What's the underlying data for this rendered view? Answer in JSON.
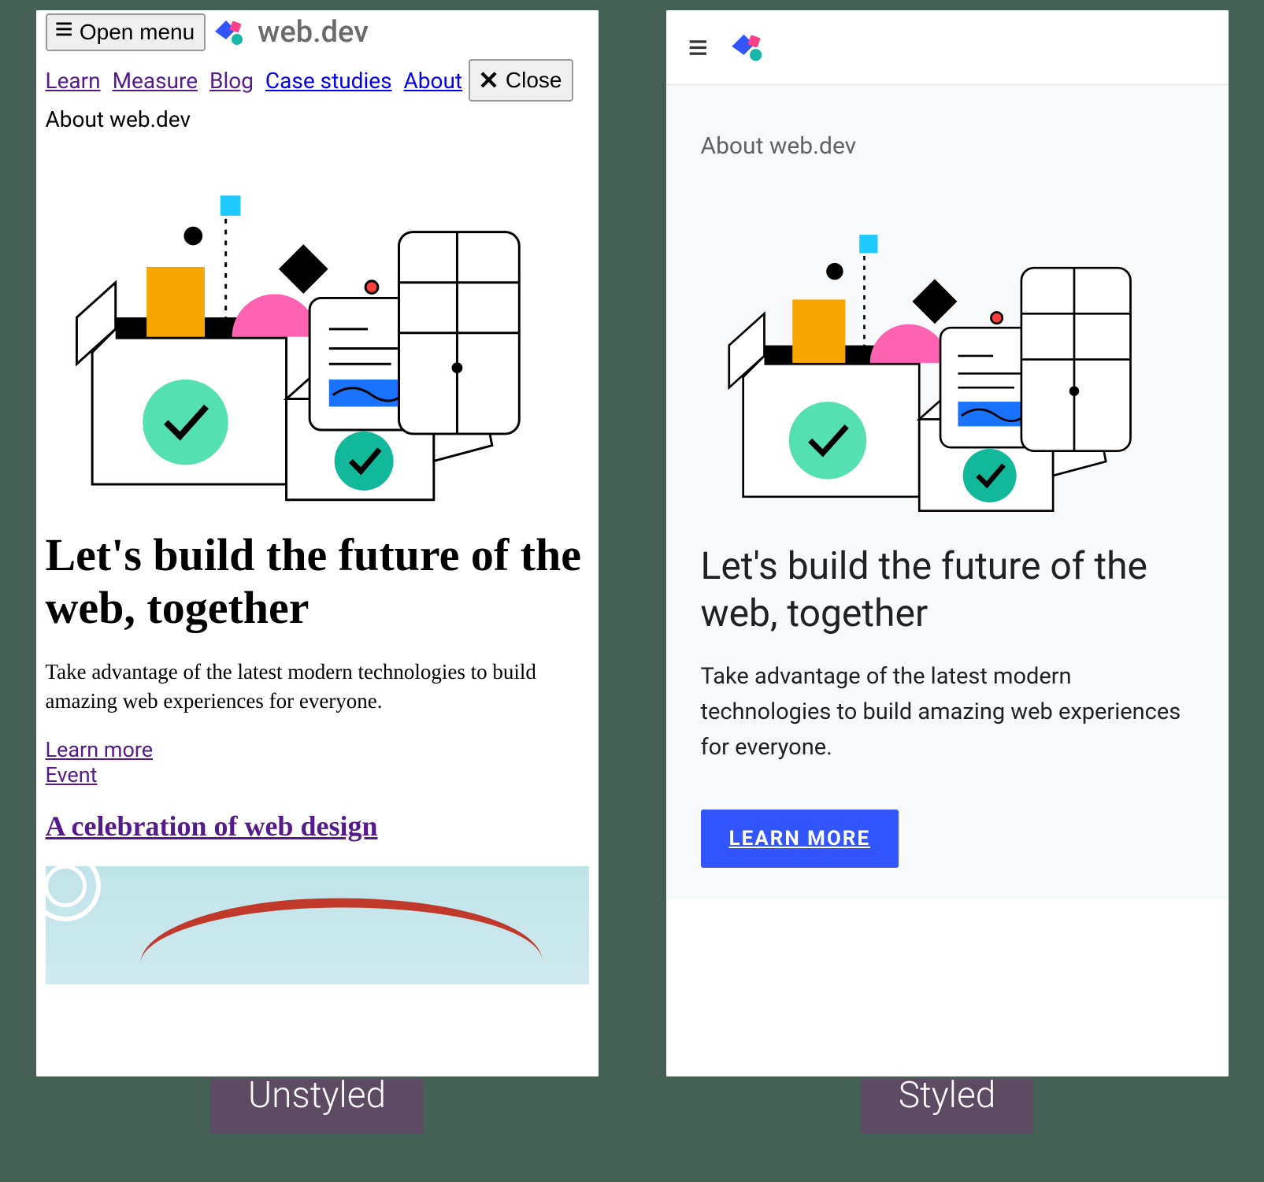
{
  "captions": {
    "left": "Unstyled",
    "right": "Styled"
  },
  "brand": {
    "name": "web.dev"
  },
  "unstyled": {
    "open_menu_label": "Open menu",
    "close_label": "Close",
    "nav": {
      "learn": "Learn",
      "measure": "Measure",
      "blog": "Blog",
      "case_studies": "Case studies",
      "about": "About"
    },
    "eyebrow": "About web.dev",
    "heading": "Let's build the future of the web, together",
    "lead": "Take advantage of the latest modern technologies to build amazing web experiences for everyone.",
    "learn_more": "Learn more",
    "event": "Event",
    "article_title": "A celebration of web design"
  },
  "styled": {
    "eyebrow": "About web.dev",
    "heading": "Let's build the future of the web, together",
    "lead": "Take advantage of the latest modern technologies to build amazing web experiences for everyone.",
    "cta": "LEARN MORE"
  }
}
